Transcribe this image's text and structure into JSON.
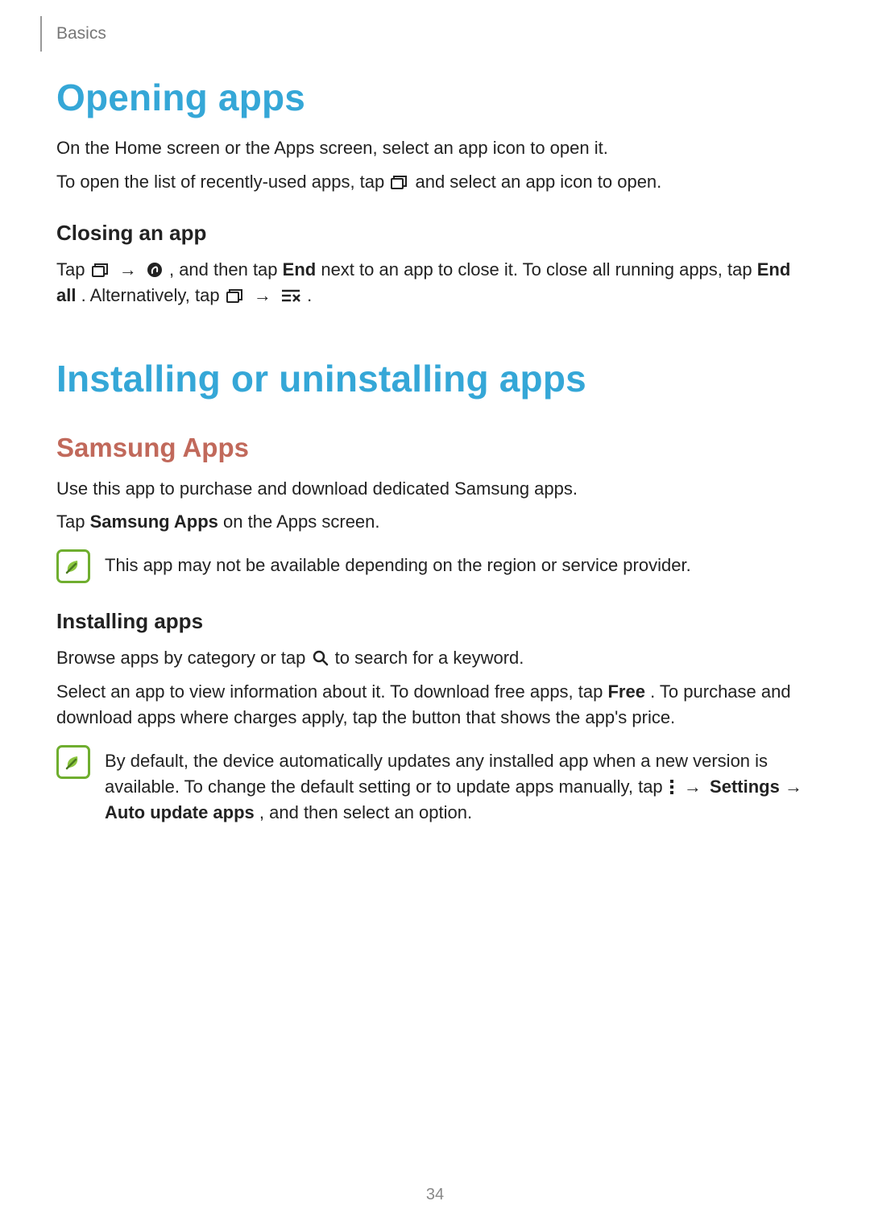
{
  "header": {
    "section": "Basics"
  },
  "h1_opening": "Opening apps",
  "opening_p1": "On the Home screen or the Apps screen, select an app icon to open it.",
  "opening_p2_a": "To open the list of recently-used apps, tap ",
  "opening_p2_b": " and select an app icon to open.",
  "h3_closing": "Closing an app",
  "closing_p1_a": "Tap ",
  "closing_p1_b": ", and then tap ",
  "closing_end": "End",
  "closing_p1_c": " next to an app to close it. To close all running apps, tap ",
  "closing_end_all": "End all",
  "closing_p1_d": ". Alternatively, tap ",
  "closing_p1_e": ".",
  "h1_install": "Installing or uninstalling apps",
  "h2_samsung": "Samsung Apps",
  "samsung_p1": "Use this app to purchase and download dedicated Samsung apps.",
  "samsung_p2_a": "Tap ",
  "samsung_apps_bold": "Samsung Apps",
  "samsung_p2_b": " on the Apps screen.",
  "note1": "This app may not be available depending on the region or service provider.",
  "h3_installing": "Installing apps",
  "installing_p1_a": "Browse apps by category or tap ",
  "installing_p1_b": " to search for a keyword.",
  "installing_p2_a": "Select an app to view information about it. To download free apps, tap ",
  "free_bold": "Free",
  "installing_p2_b": ". To purchase and download apps where charges apply, tap the button that shows the app's price.",
  "note2_a": "By default, the device automatically updates any installed app when a new version is available. To change the default setting or to update apps manually, tap ",
  "note2_settings": "Settings",
  "note2_b": " → ",
  "note2_auto": "Auto update apps",
  "note2_c": ", and then select an option.",
  "page_number": "34",
  "icons": {
    "recents": "recents-icon",
    "taskmgr": "task-manager-icon",
    "closeall": "close-all-icon",
    "search": "search-icon",
    "more": "more-icon",
    "note": "note-leaf-icon"
  }
}
